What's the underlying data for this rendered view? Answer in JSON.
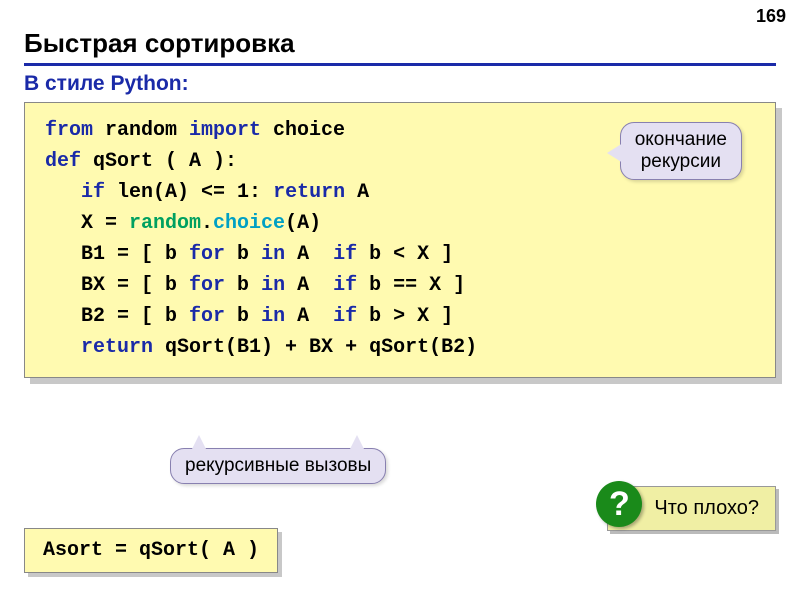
{
  "pageNumber": "169",
  "title": "Быстрая сортировка",
  "subtitle": "В стиле Python:",
  "callouts": {
    "endRecursion": "окончание\nрекурсии",
    "recursiveCalls": "рекурсивные вызовы"
  },
  "question": "Что плохо?",
  "questionMark": "?",
  "code": {
    "l1": {
      "a": "from",
      "b": " random ",
      "c": "import",
      "d": " choice"
    },
    "l2": {
      "a": "def",
      "b": " qSort ( A ):"
    },
    "l3": {
      "a": "   ",
      "b": "if",
      "c": " len(A) <= 1: ",
      "d": "return",
      "e": " A"
    },
    "l4": {
      "a": "   X = ",
      "b": "random",
      "c": ".",
      "d": "choice",
      "e": "(A)"
    },
    "l5": {
      "a": "   B1 = [ b ",
      "b": "for",
      "c": " b ",
      "d": "in",
      "e": " A  ",
      "f": "if",
      "g": " b < X ]"
    },
    "l6": {
      "a": "   BX = [ b ",
      "b": "for",
      "c": " b ",
      "d": "in",
      "e": " A  ",
      "f": "if",
      "g": " b == X ]"
    },
    "l7": {
      "a": "   B2 = [ b ",
      "b": "for",
      "c": " b ",
      "d": "in",
      "e": " A  ",
      "f": "if",
      "g": " b > X ]"
    },
    "l8": {
      "a": "   ",
      "b": "return",
      "c": " qSort(B1) + BX + qSort(B2)"
    }
  },
  "asort": "Asort = qSort( A )"
}
